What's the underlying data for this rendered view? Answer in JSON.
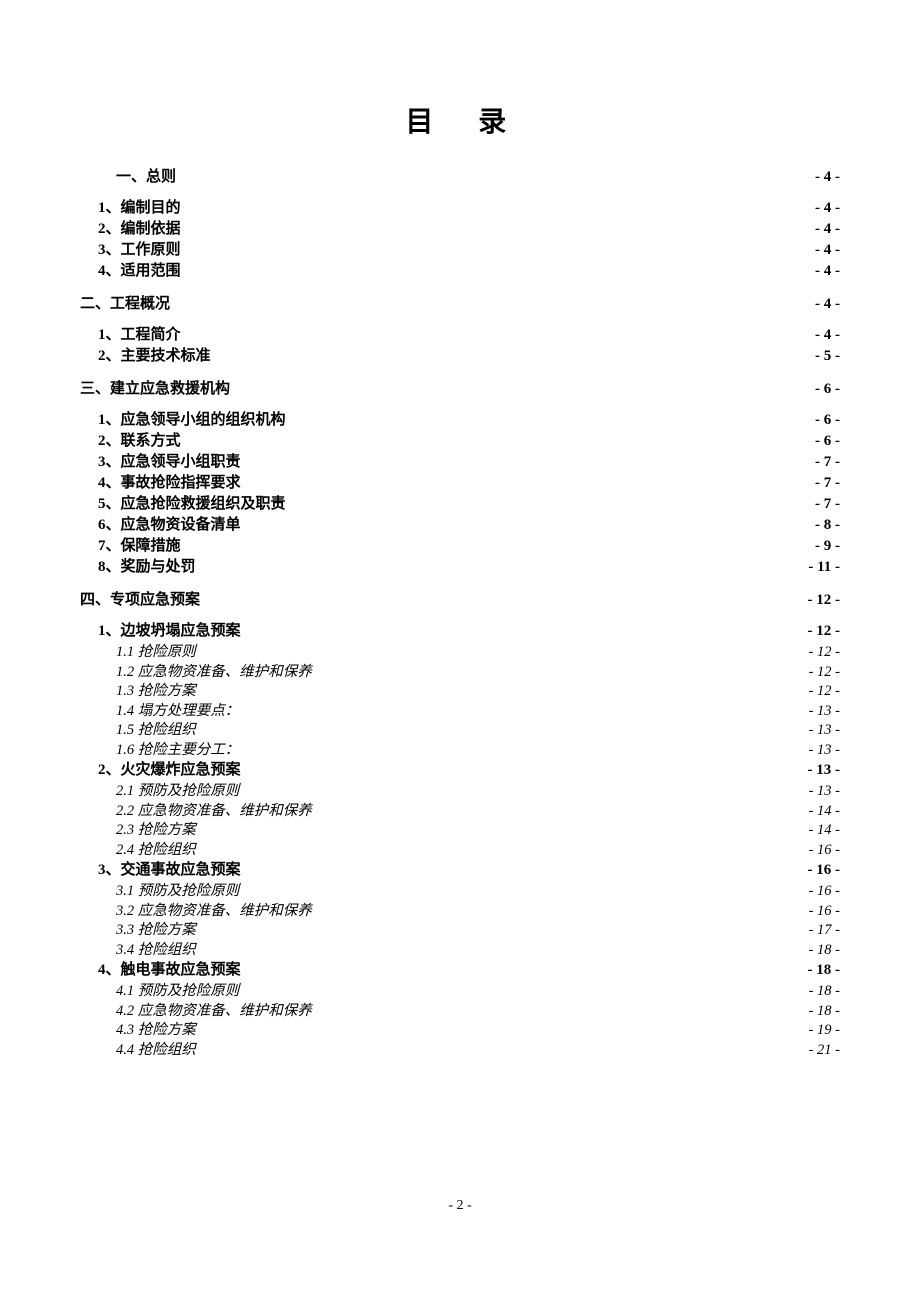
{
  "title": "目　录",
  "footer": "- 2 -",
  "toc": [
    {
      "level": "first-chapter",
      "label": "一、总则",
      "page": "- 4 -"
    },
    {
      "level": "section",
      "label": "1、编制目的",
      "page": "- 4 -"
    },
    {
      "level": "section",
      "label": "2、编制依据",
      "page": "- 4 -"
    },
    {
      "level": "section",
      "label": "3、工作原则",
      "page": "- 4 -"
    },
    {
      "level": "section",
      "label": "4、适用范围",
      "page": "- 4 -"
    },
    {
      "level": "chapter",
      "label": "二、工程概况",
      "page": "- 4 -"
    },
    {
      "level": "section",
      "label": "1、工程简介",
      "page": "- 4 -"
    },
    {
      "level": "section",
      "label": "2、主要技术标准",
      "page": "- 5 -"
    },
    {
      "level": "chapter",
      "label": "三、建立应急救援机构",
      "page": "- 6 -"
    },
    {
      "level": "section",
      "label": "1、应急领导小组的组织机构",
      "page": "- 6 -"
    },
    {
      "level": "section",
      "label": "2、联系方式",
      "page": "- 6 -"
    },
    {
      "level": "section",
      "label": "3、应急领导小组职责",
      "page": "- 7 -"
    },
    {
      "level": "section",
      "label": "4、事故抢险指挥要求",
      "page": "- 7 -"
    },
    {
      "level": "section",
      "label": "5、应急抢险救援组织及职责",
      "page": "- 7 -"
    },
    {
      "level": "section",
      "label": "6、应急物资设备清单",
      "page": "- 8 -"
    },
    {
      "level": "section",
      "label": "7、保障措施",
      "page": "- 9 -"
    },
    {
      "level": "section",
      "label": "8、奖励与处罚",
      "page": "- 11 -"
    },
    {
      "level": "chapter",
      "label": "四、专项应急预案",
      "page": "- 12 -"
    },
    {
      "level": "section",
      "label": "1、边坡坍塌应急预案",
      "page": "- 12 -"
    },
    {
      "level": "sub",
      "label": "1.1 抢险原则",
      "page": "- 12 -"
    },
    {
      "level": "sub",
      "label": "1.2 应急物资准备、维护和保养",
      "page": "- 12 -"
    },
    {
      "level": "sub",
      "label": "1.3 抢险方案",
      "page": "- 12 -"
    },
    {
      "level": "sub",
      "label": "1.4 塌方处理要点：",
      "page": "- 13 -"
    },
    {
      "level": "sub",
      "label": "1.5 抢险组织",
      "page": "- 13 -"
    },
    {
      "level": "sub",
      "label": "1.6 抢险主要分工：",
      "page": "- 13 -"
    },
    {
      "level": "section",
      "label": "2、火灾爆炸应急预案",
      "page": "- 13 -"
    },
    {
      "level": "sub",
      "label": "2.1 预防及抢险原则",
      "page": "- 13 -"
    },
    {
      "level": "sub",
      "label": "2.2 应急物资准备、维护和保养",
      "page": "- 14 -"
    },
    {
      "level": "sub",
      "label": "2.3 抢险方案",
      "page": "- 14 -"
    },
    {
      "level": "sub",
      "label": "2.4 抢险组织",
      "page": "- 16 -"
    },
    {
      "level": "section",
      "label": "3、交通事故应急预案",
      "page": "- 16 -"
    },
    {
      "level": "sub",
      "label": "3.1 预防及抢险原则",
      "page": "- 16 -"
    },
    {
      "level": "sub",
      "label": "3.2 应急物资准备、维护和保养",
      "page": "- 16 -"
    },
    {
      "level": "sub",
      "label": "3.3 抢险方案",
      "page": "- 17 -"
    },
    {
      "level": "sub",
      "label": "3.4 抢险组织",
      "page": "- 18 -"
    },
    {
      "level": "section",
      "label": "4、触电事故应急预案",
      "page": "- 18 -"
    },
    {
      "level": "sub",
      "label": "4.1 预防及抢险原则",
      "page": "- 18 -"
    },
    {
      "level": "sub",
      "label": "4.2 应急物资准备、维护和保养",
      "page": "- 18 -"
    },
    {
      "level": "sub",
      "label": "4.3 抢险方案",
      "page": "- 19 -"
    },
    {
      "level": "sub",
      "label": "4.4 抢险组织",
      "page": "- 21 -"
    }
  ]
}
